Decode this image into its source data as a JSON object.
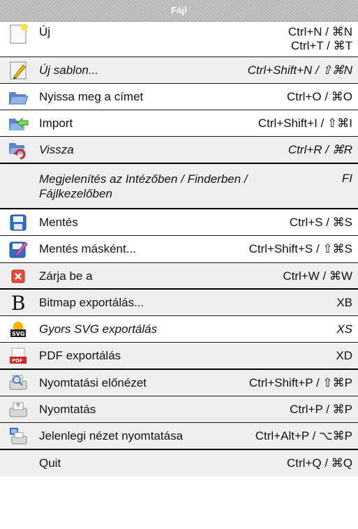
{
  "header": {
    "title": "Fájl"
  },
  "items": [
    {
      "label": "Új",
      "shortcut": "Ctrl+N / ⌘N",
      "shortcut2": "Ctrl+T / ⌘T",
      "icon": "new-document-icon"
    },
    {
      "label": "Új sablon...",
      "shortcut": "Ctrl+Shift+N / ⇧⌘N",
      "icon": "pencil-template-icon"
    },
    {
      "label": "Nyissa meg a címet",
      "shortcut": "Ctrl+O / ⌘O",
      "icon": "open-folder-icon"
    },
    {
      "label": "Import",
      "shortcut": "Ctrl+Shift+I / ⇧⌘I",
      "icon": "import-arrow-icon"
    },
    {
      "label": "Vissza",
      "shortcut": "Ctrl+R / ⌘R",
      "icon": "revert-icon"
    },
    {
      "label": "Megjelenítés az Intézőben / Finderben /",
      "label2": "Fájlkezelőben",
      "shortcut": "FI",
      "icon": "none"
    },
    {
      "label": "Mentés",
      "shortcut": "Ctrl+S / ⌘S",
      "icon": "save-disk-icon"
    },
    {
      "label": "Mentés másként...",
      "shortcut": "Ctrl+Shift+S / ⇧⌘S",
      "icon": "save-as-icon"
    },
    {
      "label": "Zárja be a",
      "shortcut": "Ctrl+W / ⌘W",
      "icon": "close-x-icon"
    },
    {
      "label": "Bitmap exportálás...",
      "shortcut": "XB",
      "icon": "bitmap-b-icon"
    },
    {
      "label": "Gyors SVG exportálás",
      "shortcut": "XS",
      "icon": "svg-export-icon"
    },
    {
      "label": "PDF exportálás",
      "shortcut": "XD",
      "icon": "pdf-icon"
    },
    {
      "label": "Nyomtatási előnézet",
      "shortcut": "Ctrl+Shift+P / ⇧⌘P",
      "icon": "print-preview-icon"
    },
    {
      "label": "Nyomtatás",
      "shortcut": "Ctrl+P / ⌘P",
      "icon": "printer-icon"
    },
    {
      "label": "Jelenlegi nézet nyomtatása",
      "shortcut": "Ctrl+Alt+P / ⌥⌘P",
      "icon": "print-view-icon"
    },
    {
      "label": "Quit",
      "shortcut": "Ctrl+Q / ⌘Q",
      "icon": "none"
    }
  ]
}
